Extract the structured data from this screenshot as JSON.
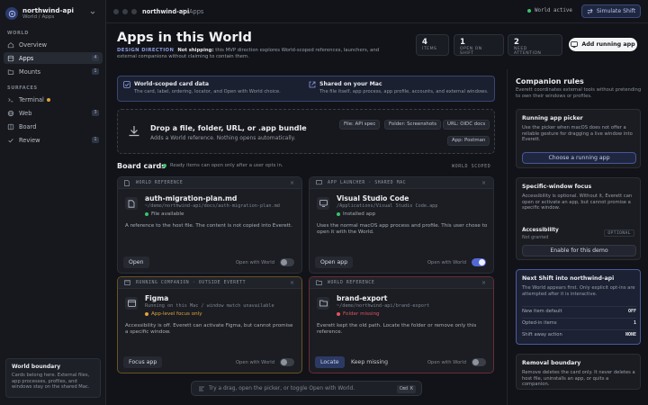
{
  "workspace": {
    "name": "northwind-api",
    "sub": "World / Apps"
  },
  "sidebar": {
    "world_label": "WORLD",
    "surfaces_label": "SURFACES",
    "items": [
      {
        "label": "Overview",
        "icon": "home-icon",
        "count": ""
      },
      {
        "label": "Apps",
        "icon": "apps-icon",
        "count": "4",
        "active": true
      },
      {
        "label": "Mounts",
        "icon": "folder-icon",
        "count": "1"
      },
      {
        "label": "Terminal",
        "icon": "terminal-icon",
        "count": ""
      },
      {
        "label": "Web",
        "icon": "globe-icon",
        "count": "3"
      },
      {
        "label": "Board",
        "icon": "board-icon",
        "count": ""
      },
      {
        "label": "Review",
        "icon": "check-icon",
        "count": "1"
      }
    ],
    "boundary": {
      "title": "World boundary",
      "desc": "Cards belong here. External files, app processes, profiles, and windows stay on the shared Mac."
    }
  },
  "topbar": {
    "crumb_project": "northwind-api",
    "crumb_sep": "/",
    "crumb_page": "Apps",
    "world_status": "World active",
    "simulate_label": "Simulate Shift"
  },
  "header": {
    "title": "Apps in this World",
    "direction_label": "DESIGN DIRECTION",
    "direction_bold": "Not shipping:",
    "direction_text": "this MVP direction explores World-scoped references, launchers, and external companions without claiming to contain them.",
    "stats": [
      {
        "value": "4",
        "label": "ITEMS"
      },
      {
        "value": "1",
        "label": "OPEN ON SHIFT"
      },
      {
        "value": "2",
        "label": "NEED ATTENTION"
      }
    ],
    "add_label": "Add running app"
  },
  "banner": {
    "left_title": "World-scoped card data",
    "left_desc": "The card, label, ordering, locator, and Open with World choice.",
    "right_title": "Shared on your Mac",
    "right_desc": "The file itself, app process, app profile, accounts, and external windows."
  },
  "dropzone": {
    "title": "Drop a file, folder, URL, or .app bundle",
    "desc": "Adds a World reference. Nothing opens automatically.",
    "chips": [
      "File: API spec",
      "Folder: Screenshots",
      "URL: OIDC docs",
      "App: Postman"
    ]
  },
  "board": {
    "title": "Board cards",
    "note": "Ready items can open only after a user opts in.",
    "scope": "WORLD SCOPED",
    "toggle_label": "Open with World",
    "cards": [
      {
        "kind": "WORLD REFERENCE",
        "name": "auth-migration-plan.md",
        "path": "~/demo/northwind-api/docs/auth-migration-plan.md",
        "status": "File available",
        "desc": "A reference to the host file. The content is not copied into Everett.",
        "btn1": "Open",
        "btn2": "",
        "toggle": false
      },
      {
        "kind": "APP LAUNCHER · SHARED MAC",
        "name": "Visual Studio Code",
        "path": "/Applications/Visual Studio Code.app",
        "status": "Installed app",
        "desc": "Uses the normal macOS app process and profile. This user chose to open it with the World.",
        "btn1": "Open app",
        "btn2": "",
        "toggle": true
      },
      {
        "kind": "RUNNING COMPANION · OUTSIDE EVERETT",
        "name": "Figma",
        "path": "Running on this Mac / window match unavailable",
        "status": "App-level focus only",
        "desc": "Accessibility is off. Everett can activate Figma, but cannot promise a specific window.",
        "btn1": "Focus app",
        "btn2": "",
        "toggle": false
      },
      {
        "kind": "WORLD REFERENCE",
        "name": "brand-export",
        "path": "~/demo/northwind-api/brand-export",
        "status": "Folder missing",
        "desc": "Everett kept the old path. Locate the folder or remove only this reference.",
        "btn1": "Locate",
        "btn2": "Keep missing",
        "toggle": false
      }
    ]
  },
  "command": {
    "placeholder": "Try a drag, open the picker, or toggle Open with World.",
    "shortcut": "Cmd K"
  },
  "companion": {
    "title": "Companion rules",
    "desc": "Everett coordinates external tools without pretending to own their windows or profiles.",
    "picker": {
      "title": "Running app picker",
      "desc": "Use the picker when macOS does not offer a reliable gesture for dragging a live window into Everett.",
      "btn": "Choose a running app"
    },
    "focus": {
      "title": "Specific-window focus",
      "desc": "Accessibility is optional. Without it, Everett can open or activate an app, but cannot promise a specific window.",
      "acc_label": "Accessibility",
      "acc_status": "Not granted",
      "optional": "OPTIONAL",
      "btn": "Enable for this demo"
    },
    "next_shift": {
      "title": "Next Shift into northwind-api",
      "desc": "The World appears first. Only explicit opt-ins are attempted after it is interactive.",
      "rows": [
        {
          "label": "New item default",
          "value": "OFF"
        },
        {
          "label": "Opted-in items",
          "value": "1"
        },
        {
          "label": "Shift away action",
          "value": "NONE"
        }
      ]
    },
    "removal": {
      "title": "Removal boundary",
      "desc": "Remove deletes the card only. It never deletes a host file, uninstalls an app, or quits a companion."
    }
  },
  "colors": {
    "accent": "#5468d4",
    "ok": "#3cc36a",
    "warn": "#e0a33a",
    "error": "#e0545e"
  }
}
